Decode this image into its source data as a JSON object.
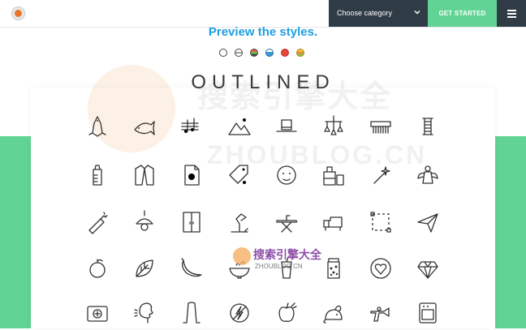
{
  "header": {
    "category_label": "Choose category",
    "cta_label": "GET STARTED"
  },
  "main": {
    "preview_title": "Preview the styles.",
    "style_title": "OUTLINED",
    "style_dots": [
      "outlined",
      "filled-outline",
      "flat-green",
      "flat-blue",
      "flat-red",
      "flat-yellow"
    ]
  },
  "icons": [
    "bird-icon",
    "fish-icon",
    "music-notes-icon",
    "mountains-icon",
    "hat-icon",
    "mobile-hanging-icon",
    "comb-icon",
    "thread-spool-icon",
    "baby-bottle-icon",
    "jacket-icon",
    "document-icon",
    "price-tag-icon",
    "face-icon",
    "furniture-icon",
    "magic-wand-icon",
    "angel-icon",
    "champagne-icon",
    "ceiling-lamp-icon",
    "wardrobe-icon",
    "desk-lamp-icon",
    "ironing-board-icon",
    "sofa-icon",
    "selection-icon",
    "paper-plane-icon",
    "orange-icon",
    "leaf-icon",
    "banana-icon",
    "bowl-icon",
    "soda-icon",
    "jar-icon",
    "heart-ring-icon",
    "diamond-icon",
    "hospital-sign-icon",
    "person-cough-icon",
    "tongs-icon",
    "no-lightning-icon",
    "apple-icon",
    "mouse-icon",
    "space-gun-icon",
    "oven-icon"
  ],
  "watermark": {
    "big_cn": "搜索引擎大全",
    "big_domain": "ZHOUBLOG.CN",
    "small_cn": "搜索引擎大全",
    "small_domain": "ZHOUBLOG.CN"
  }
}
